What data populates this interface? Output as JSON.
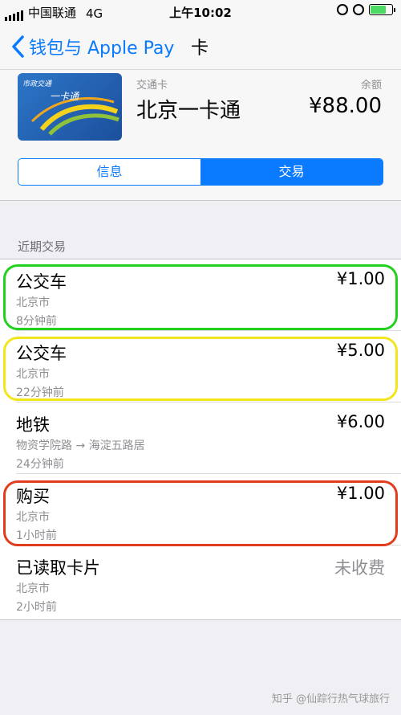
{
  "status_bar": {
    "carrier": "中国联通",
    "network": "4G",
    "time": "上午10:02",
    "battery_level": 0.72
  },
  "nav": {
    "back_label": "钱包与 Apple Pay",
    "title": "卡"
  },
  "card": {
    "image_logo_text": "市政交通",
    "image_name_text": "一卡通",
    "type_label": "交通卡",
    "title": "北京一卡通",
    "balance_label": "余额",
    "balance_value": "¥88.00"
  },
  "segmented": {
    "tabs": [
      {
        "label": "信息"
      },
      {
        "label": "交易"
      }
    ],
    "selected": "交易"
  },
  "section_header": "近期交易",
  "transactions": [
    {
      "name": "公交车",
      "amount": "¥1.00",
      "location": "北京市",
      "time": "8分钟前",
      "highlight_color": "#22d11e"
    },
    {
      "name": "公交车",
      "amount": "¥5.00",
      "location": "北京市",
      "time": "22分钟前",
      "highlight_color": "#f2e51c"
    },
    {
      "name": "地铁",
      "amount": "¥6.00",
      "location": "物资学院路 → 海淀五路居",
      "time": "24分钟前"
    },
    {
      "name": "购买",
      "amount": "¥1.00",
      "location": "北京市",
      "time": "1小时前",
      "highlight_color": "#e23c1e"
    },
    {
      "name": "已读取卡片",
      "amount": "未收费",
      "location": "北京市",
      "time": "2小时前"
    }
  ],
  "watermark": "知乎 @仙踪行热气球旅行",
  "colors": {
    "accent": "#0a7aff",
    "battery": "#4cd964"
  }
}
